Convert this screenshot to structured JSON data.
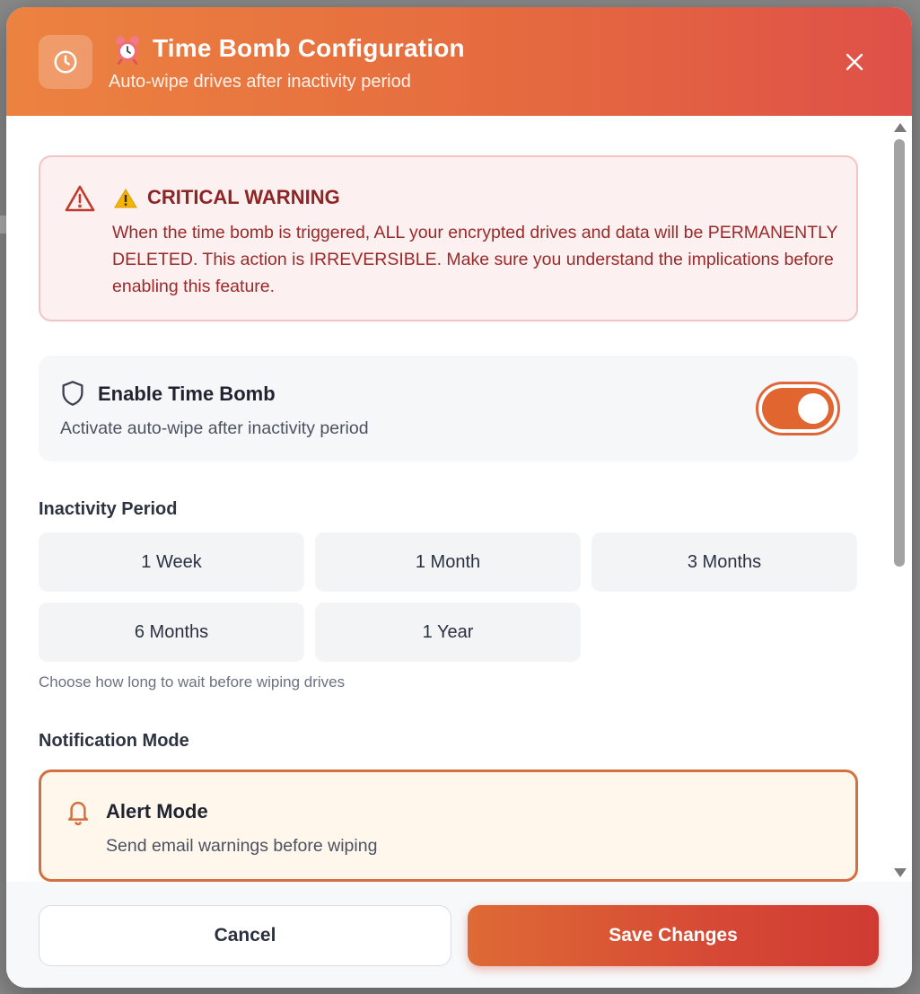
{
  "header": {
    "title": "Time Bomb Configuration",
    "subtitle": "Auto-wipe drives after inactivity period",
    "icon": "clock-icon",
    "emoji": "alarm-clock-emoji"
  },
  "warning": {
    "title": "CRITICAL WARNING",
    "text": "When the time bomb is triggered, ALL your encrypted drives and data will be PERMANENTLY DELETED. This action is IRREVERSIBLE. Make sure you understand the implications before enabling this feature.",
    "color": "#8f2424"
  },
  "enable": {
    "title": "Enable Time Bomb",
    "description": "Activate auto-wipe after inactivity period",
    "enabled": true,
    "accent": "#e0652f"
  },
  "inactivity": {
    "label": "Inactivity Period",
    "options": [
      "1 Week",
      "1 Month",
      "3 Months",
      "6 Months",
      "1 Year"
    ],
    "helper": "Choose how long to wait before wiping drives"
  },
  "notification": {
    "label": "Notification Mode",
    "selected": {
      "title": "Alert Mode",
      "description": "Send email warnings before wiping"
    }
  },
  "footer": {
    "cancel_label": "Cancel",
    "save_label": "Save Changes"
  }
}
